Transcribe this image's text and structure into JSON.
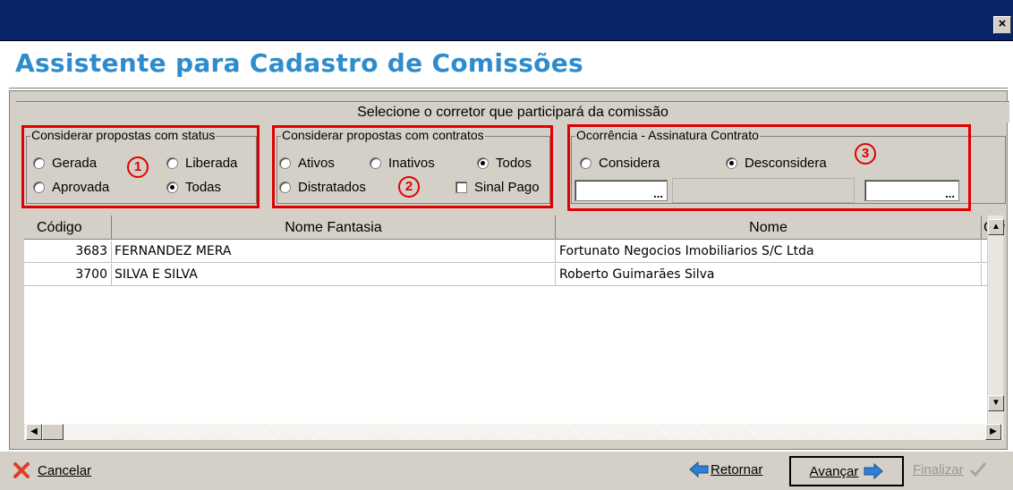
{
  "window": {
    "close_label": "×"
  },
  "wizard": {
    "title": "Assistente para Cadastro de Comissões",
    "panel_header": "Selecione o corretor que participará da comissão"
  },
  "group_status": {
    "legend": "Considerar propostas com status",
    "options": [
      "Gerada",
      "Liberada",
      "Aprovada",
      "Todas"
    ],
    "selected": "Todas"
  },
  "group_contratos": {
    "legend": "Considerar propostas com contratos",
    "options": [
      "Ativos",
      "Inativos",
      "Todos",
      "Distratados"
    ],
    "selected": "Todos",
    "checkbox_label": "Sinal Pago",
    "checkbox_checked": false
  },
  "group_ocorrencia": {
    "legend": "Ocorrência - Assinatura Contrato",
    "options": [
      "Considera",
      "Desconsidera"
    ],
    "selected": "Desconsidera",
    "ellipsis": "..."
  },
  "annotations": [
    "1",
    "2",
    "3"
  ],
  "grid": {
    "columns": [
      "Código",
      "Nome Fantasia",
      "Nome",
      "Cor"
    ],
    "rows": [
      {
        "codigo": "3683",
        "fantasia": "FERNANDEZ MERA",
        "nome": "Fortunato Negocios Imobiliarios S/C Ltda"
      },
      {
        "codigo": "3700",
        "fantasia": "SILVA E SILVA",
        "nome": "Roberto Guimarães Silva"
      }
    ]
  },
  "buttons": {
    "cancel": "Cancelar",
    "back": "Retornar",
    "next": "Avançar",
    "finish": "Finalizar"
  },
  "colors": {
    "title_blue": "#2e8ccd",
    "annotation_red": "#e00000",
    "titlebar": "#0a246a"
  }
}
